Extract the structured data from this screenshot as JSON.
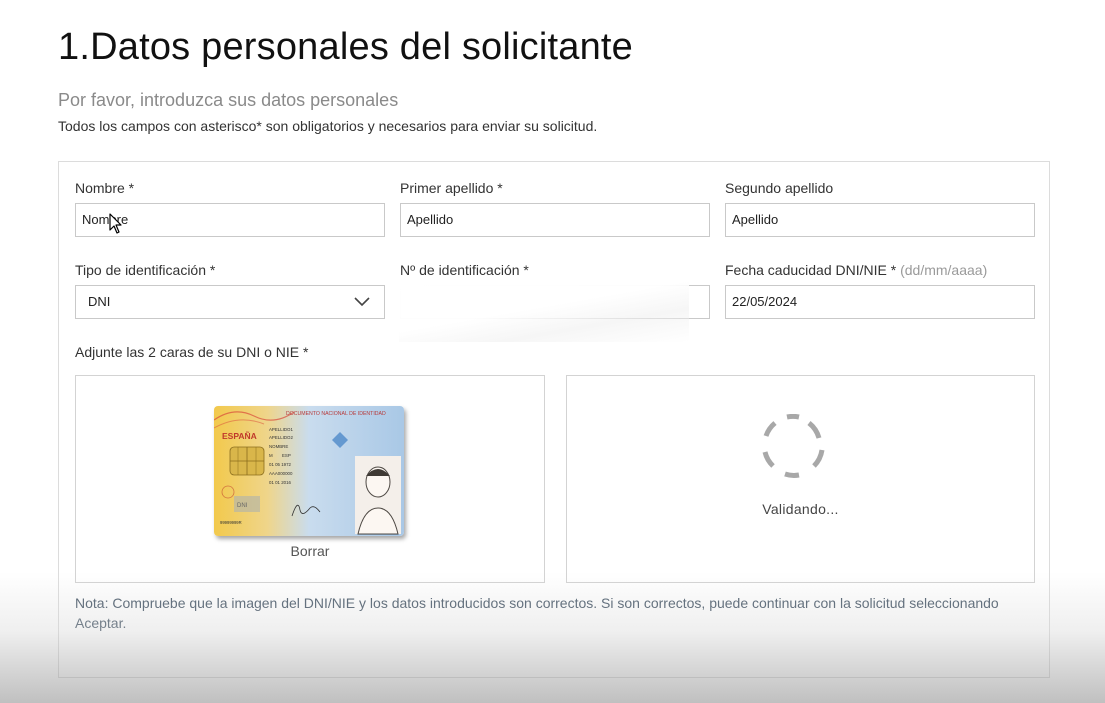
{
  "page": {
    "title": "1.Datos personales del solicitante",
    "subtitle": "Por favor, introduzca sus datos personales",
    "required_note": "Todos los campos con asterisco* son obligatorios y necesarios para enviar su solicitud."
  },
  "form": {
    "nombre": {
      "label": "Nombre *",
      "value": "Nombre"
    },
    "primer_apellido": {
      "label": "Primer apellido *",
      "value": "Apellido"
    },
    "segundo_apellido": {
      "label": "Segundo apellido",
      "value": "Apellido"
    },
    "tipo_identificacion": {
      "label": "Tipo de identificación *",
      "selected": "DNI"
    },
    "numero_identificacion": {
      "label": "Nº de identificación *",
      "value": ""
    },
    "fecha_caducidad": {
      "label": "Fecha caducidad DNI/NIE *",
      "hint": "(dd/mm/aaaa)",
      "value": "22/05/2024"
    }
  },
  "upload": {
    "label": "Adjunte las 2 caras de su DNI o NIE *",
    "front": {
      "delete_label": "Borrar",
      "card": {
        "header": "DOCUMENTO NACIONAL DE IDENTIDAD",
        "country": "ESPAÑA",
        "surname1": "APELLIDO1",
        "surname2": "APELLIDO2",
        "name": "NOMBRE",
        "sex": "M",
        "nationality": "ESP",
        "birth_date": "01 05 1972",
        "support_number": "AAA000000",
        "validity": "01 01 2016",
        "dni_number": "99999999R",
        "card_footer": "DNI"
      }
    },
    "back": {
      "status": "Validando..."
    }
  },
  "note": "Nota: Compruebe que la imagen del DNI/NIE y los datos introducidos son correctos. Si son correctos, puede continuar con la solicitud seleccionando Aceptar.",
  "colors": {
    "spinner": "#a8a8a8",
    "note_text": "#4b5b6b",
    "card_yellow": "#f0c84a",
    "card_blue": "#a9c8e6"
  },
  "icons": {
    "dropdown": "chevron-down-icon",
    "spinner": "loading-spinner-icon",
    "cursor": "mouse-cursor-icon"
  }
}
